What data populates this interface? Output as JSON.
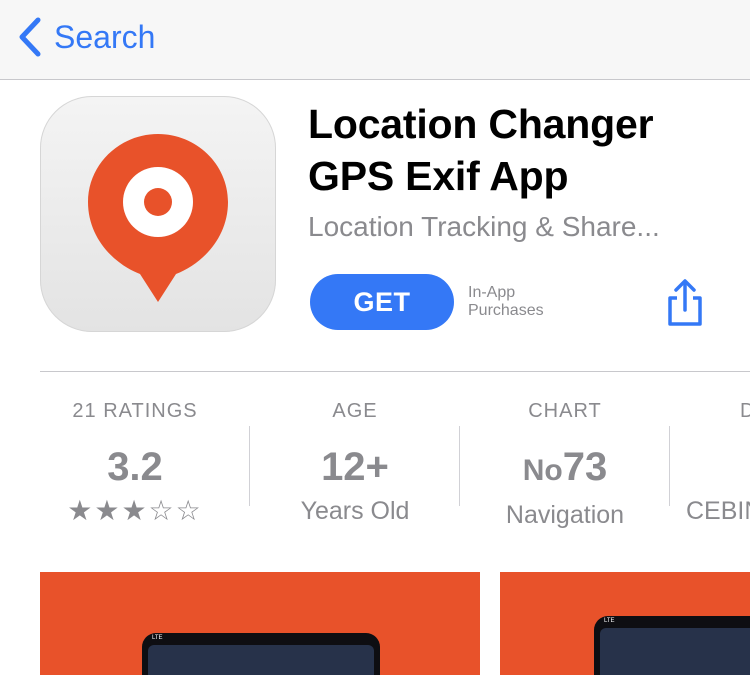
{
  "navbar": {
    "back_label": "Search",
    "back_icon": "chevron-left-icon",
    "accent_color": "#3478f6"
  },
  "app": {
    "icon": "location-pin-icon",
    "icon_color": "#e8522a",
    "title_line1": "Location Changer",
    "title_line2": "GPS Exif App",
    "subtitle": "Location Tracking & Share...",
    "get_label": "GET",
    "iap_line1": "In-App",
    "iap_line2": "Purchases",
    "share_icon": "share-icon"
  },
  "info": {
    "ratings": {
      "label": "21 RATINGS",
      "value": "3.2",
      "stars": "★★★☆☆",
      "star_fraction": 0.64
    },
    "age": {
      "label": "AGE",
      "value": "12+",
      "sub": "Years Old"
    },
    "chart": {
      "label": "CHART",
      "prefix": "No",
      "value": "73",
      "sub": "Navigation"
    },
    "developer": {
      "label": "D",
      "sub": "CEBIN"
    }
  },
  "screenshots": {
    "shot1_status": "LTE",
    "shot2_status": "LTE",
    "background_color": "#e8522a"
  }
}
